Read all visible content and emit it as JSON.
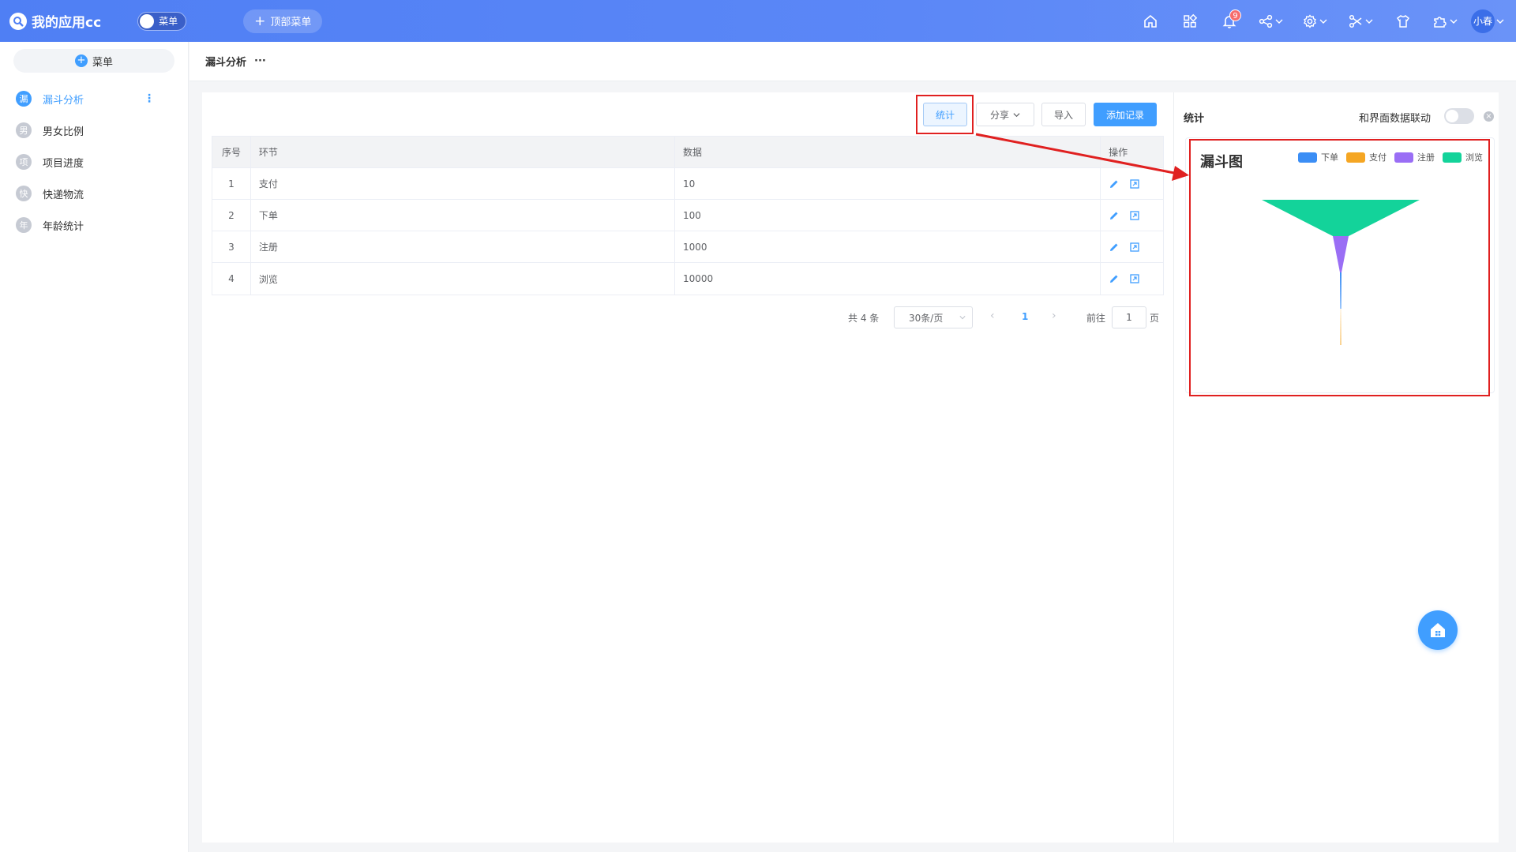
{
  "app": {
    "title": "我的应用cc",
    "menu_toggle_label": "菜单",
    "top_menu_label": "顶部菜单"
  },
  "topbar": {
    "notification_count": "9",
    "user_name": "小春"
  },
  "sidebar": {
    "add_menu_label": "菜单",
    "items": [
      {
        "icon_char": "漏",
        "label": "漏斗分析",
        "active": true
      },
      {
        "icon_char": "男",
        "label": "男女比例"
      },
      {
        "icon_char": "项",
        "label": "项目进度"
      },
      {
        "icon_char": "快",
        "label": "快递物流"
      },
      {
        "icon_char": "年",
        "label": "年龄统计"
      }
    ]
  },
  "breadcrumb": {
    "title": "漏斗分析",
    "more": "···"
  },
  "toolbar": {
    "stat": "统计",
    "share": "分享",
    "import": "导入",
    "add": "添加记录"
  },
  "table": {
    "headers": [
      "序号",
      "环节",
      "数据",
      "操作"
    ],
    "rows": [
      {
        "idx": "1",
        "step": "支付",
        "value": "10"
      },
      {
        "idx": "2",
        "step": "下单",
        "value": "100"
      },
      {
        "idx": "3",
        "step": "注册",
        "value": "1000"
      },
      {
        "idx": "4",
        "step": "浏览",
        "value": "10000"
      }
    ]
  },
  "pagination": {
    "total": "共 4 条",
    "page_size": "30条/页",
    "current": "1",
    "goto_label": "前往",
    "goto_value": "1",
    "page_suffix": "页"
  },
  "right_panel": {
    "title": "统计",
    "link_label": "和界面数据联动"
  },
  "chart_data": {
    "type": "funnel",
    "title": "漏斗图",
    "legend": [
      "下单",
      "支付",
      "注册",
      "浏览"
    ],
    "colors": {
      "下单": "#3b8ef5",
      "支付": "#f5a623",
      "注册": "#9a6ef5",
      "浏览": "#13d39a"
    },
    "series": [
      {
        "name": "浏览",
        "value": 10000
      },
      {
        "name": "注册",
        "value": 1000
      },
      {
        "name": "下单",
        "value": 100
      },
      {
        "name": "支付",
        "value": 10
      }
    ]
  }
}
